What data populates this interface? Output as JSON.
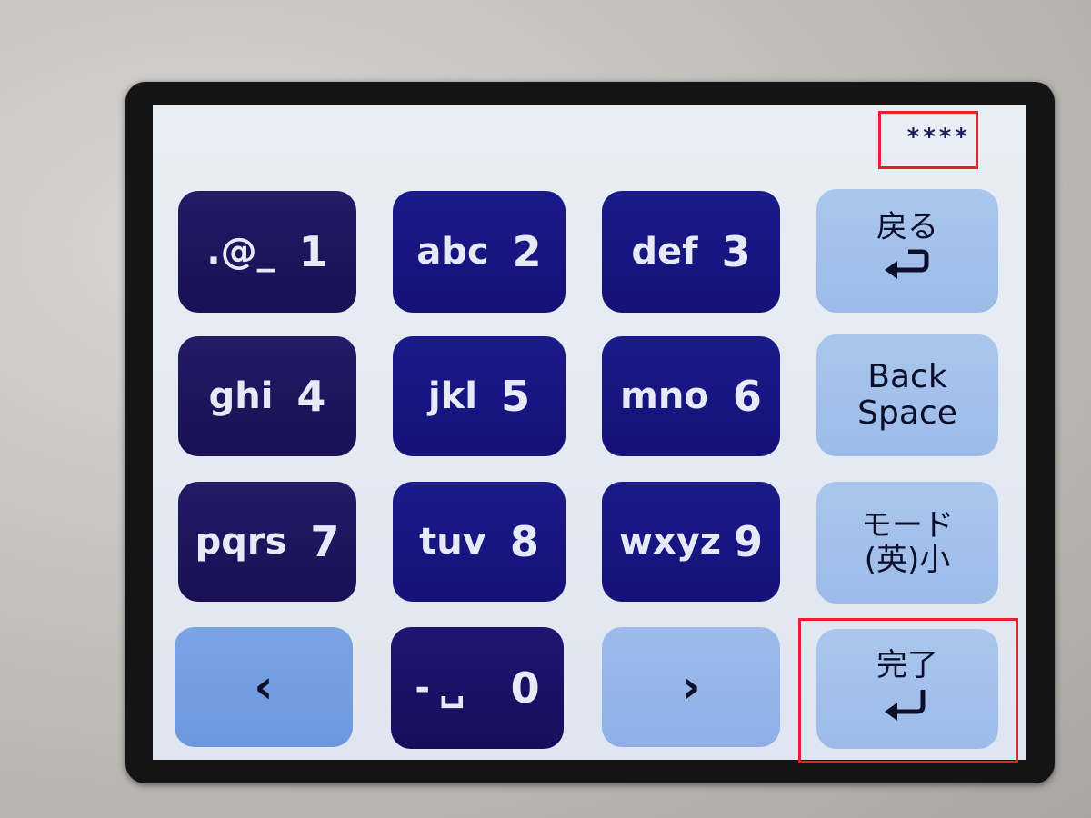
{
  "password_display": "****",
  "keys": {
    "k1": {
      "letters": ".@_",
      "digit": "1"
    },
    "k2": {
      "letters": "abc",
      "digit": "2"
    },
    "k3": {
      "letters": "def",
      "digit": "3"
    },
    "k4": {
      "letters": "ghi",
      "digit": "4"
    },
    "k5": {
      "letters": "jkl",
      "digit": "5"
    },
    "k6": {
      "letters": "mno",
      "digit": "6"
    },
    "k7": {
      "letters": "pqrs",
      "digit": "7"
    },
    "k8": {
      "letters": "tuv",
      "digit": "8"
    },
    "k9": {
      "letters": "wxyz",
      "digit": "9"
    },
    "k0": {
      "letters": "-␣",
      "digit": "0"
    }
  },
  "side_keys": {
    "back_label": "戻る",
    "backspace_line1": "Back",
    "backspace_line2": "Space",
    "mode_line1": "モード",
    "mode_line2": "(英)小",
    "done_label": "完了"
  },
  "nav": {
    "left": "‹",
    "right": "›"
  },
  "icons": {
    "back": "return-arrow-icon",
    "done": "enter-arrow-icon",
    "left": "chevron-left-icon",
    "right": "chevron-right-icon"
  },
  "colors": {
    "highlight": "#e8202a",
    "key_dark": "#1b1278",
    "key_light": "#a3c1ec",
    "screen_bg": "#e4eaf2"
  }
}
